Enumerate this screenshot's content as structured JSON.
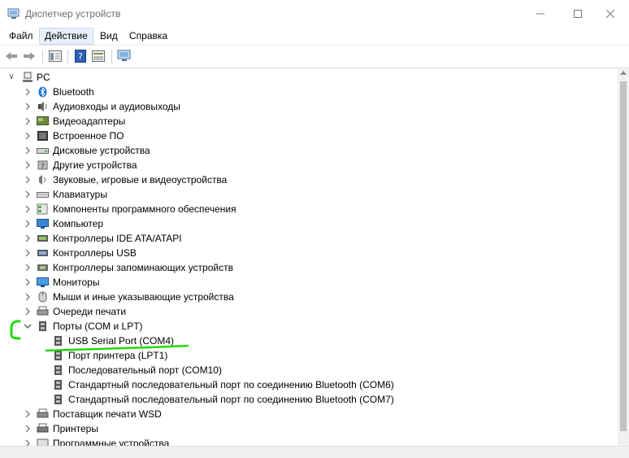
{
  "window": {
    "title": "Диспетчер устройств"
  },
  "menu": {
    "file": "Файл",
    "action": "Действие",
    "view": "Вид",
    "help": "Справка"
  },
  "tree": {
    "root": "PC",
    "categories": [
      "Bluetooth",
      "Аудиовходы и аудиовыходы",
      "Видеоадаптеры",
      "Встроенное ПО",
      "Дисковые устройства",
      "Другие устройства",
      "Звуковые, игровые и видеоустройства",
      "Клавиатуры",
      "Компоненты программного обеспечения",
      "Компьютер",
      "Контроллеры IDE ATA/ATAPI",
      "Контроллеры USB",
      "Контроллеры запоминающих устройств",
      "Мониторы",
      "Мыши и иные указывающие устройства",
      "Очереди печати",
      "Порты (COM и LPT)"
    ],
    "ports_children": [
      "USB Serial Port (COM4)",
      "Порт принтера (LPT1)",
      "Последовательный порт (COM10)",
      "Стандартный последовательный порт по соединению Bluetooth (COM6)",
      "Стандартный последовательный порт по соединению Bluetooth (COM7)"
    ],
    "after_ports": [
      "Поставщик печати WSD",
      "Принтеры",
      "Программные устройства"
    ]
  },
  "colors": {
    "annotation": "#22d80a",
    "selection": "#cce8ff"
  }
}
